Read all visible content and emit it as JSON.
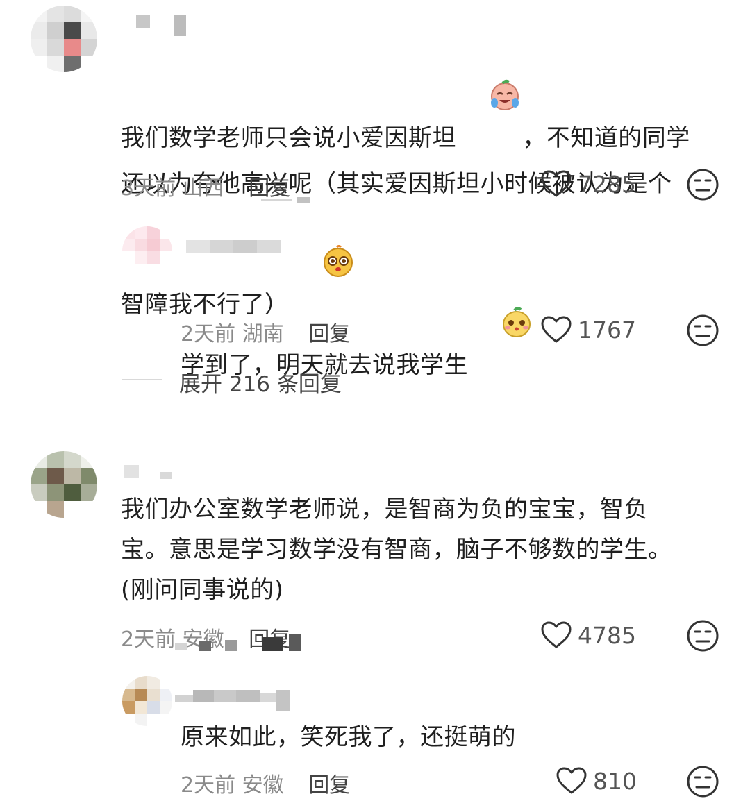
{
  "comments": [
    {
      "text_lines": [
        "我们数学老师只会说小爱因斯坦",
        "，不知道的同学",
        "还以为夸他高兴呢（其实爱因斯坦小时候被认为是个",
        "智障我不行了）"
      ],
      "emoji_1": "crying-laughing-emoji",
      "emoji_2": "smirk-emoji",
      "time": "3天前",
      "location": "山西",
      "reply_label": "回复",
      "likes": "7285",
      "replies": [
        {
          "text": "学到了，明天就去说我学生",
          "emoji": "shy-smile-emoji",
          "time": "2天前",
          "location": "湖南",
          "reply_label": "回复",
          "likes": "1767"
        }
      ],
      "expand_label": "展开 216 条回复"
    },
    {
      "text_lines": [
        "我们办公室数学老师说，是智商为负的宝宝，智负",
        "宝。意思是学习数学没有智商，脑子不够数的学生。",
        "(刚问同事说的)"
      ],
      "time": "2天前",
      "location": "安徽",
      "reply_label": "回复",
      "likes": "4785",
      "replies": [
        {
          "text": "原来如此，笑死我了，还挺萌的",
          "time": "2天前",
          "location": "安徽",
          "reply_label": "回复",
          "likes": "810"
        }
      ]
    }
  ],
  "icons": {
    "like": "heart-outline-icon",
    "dislike": "neutral-face-icon"
  },
  "colors": {
    "text": "#1f1f1f",
    "meta": "#8a8a8a",
    "icon": "#333333"
  }
}
